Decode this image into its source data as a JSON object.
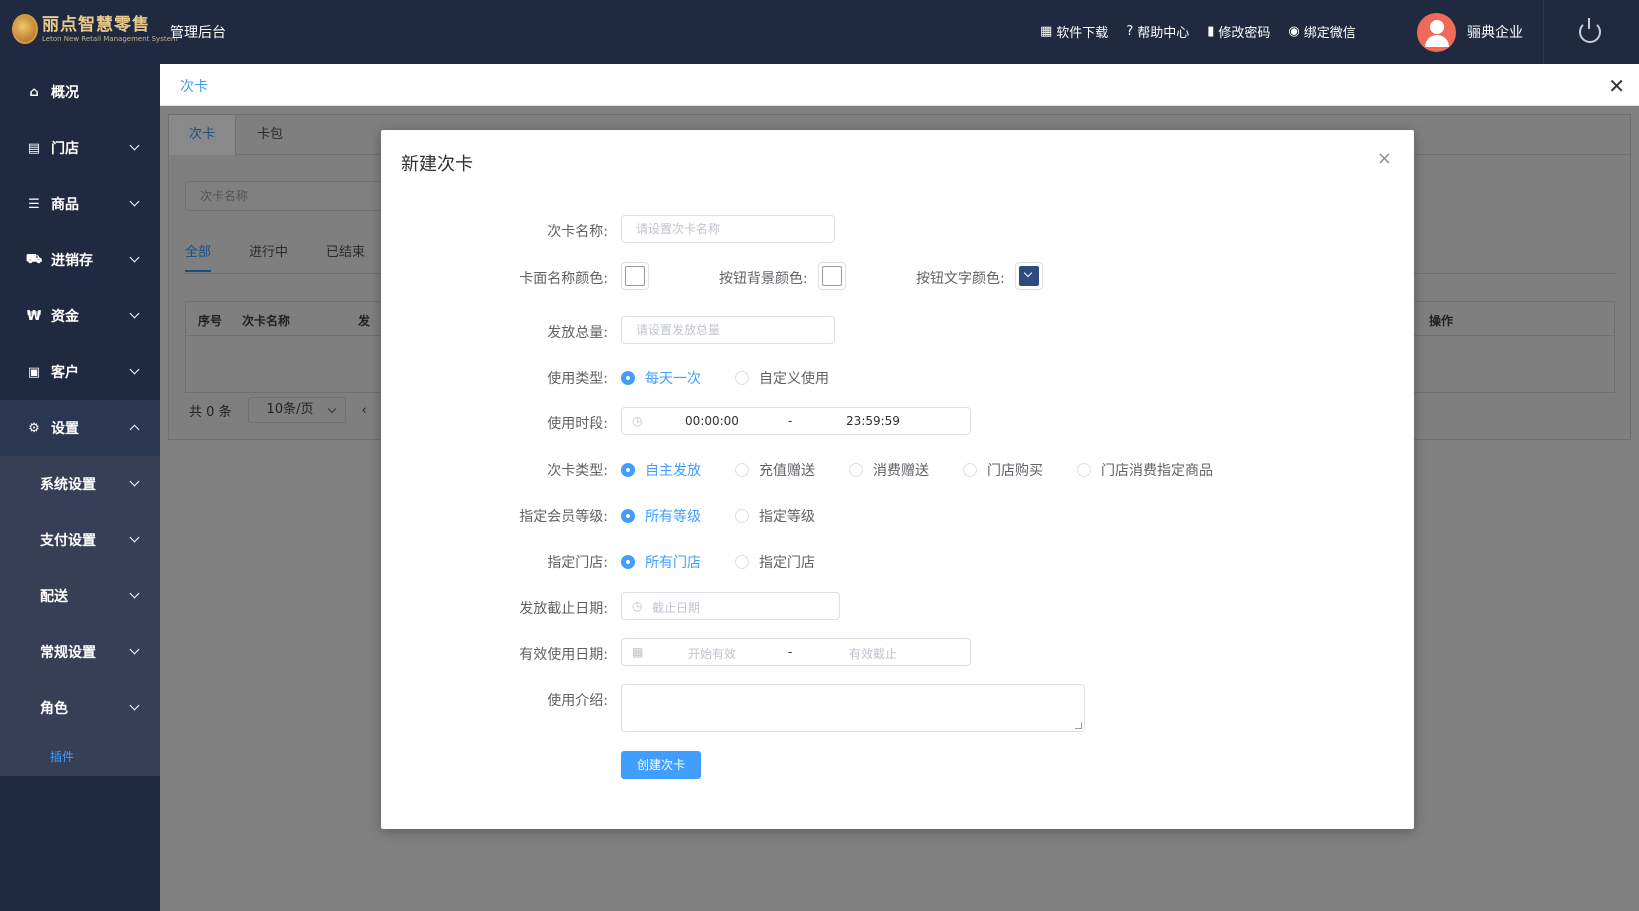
{
  "header": {
    "logo_text": "丽点智慧零售",
    "logo_subtext": "Leton New Retail Management System",
    "admin_title": "管理后台",
    "links": [
      {
        "icon": "store-icon",
        "glyph": "▦",
        "label": "软件下载"
      },
      {
        "icon": "help-icon",
        "glyph": "?",
        "label": "帮助中心"
      },
      {
        "icon": "thermometer-icon",
        "glyph": "▮",
        "label": "修改密码"
      },
      {
        "icon": "wechat-icon",
        "glyph": "◉",
        "label": "绑定微信"
      }
    ],
    "company": "骊典企业",
    "avatar_color": "#ef6a58"
  },
  "sidebar": {
    "items": [
      {
        "icon": "home-icon",
        "glyph": "⌂",
        "label": "概况"
      },
      {
        "icon": "document-icon",
        "glyph": "▤",
        "label": "门店"
      },
      {
        "icon": "list-icon",
        "glyph": "☰",
        "label": "商品"
      },
      {
        "icon": "truck-icon",
        "glyph": "⛟",
        "label": "进销存"
      },
      {
        "icon": "won-icon",
        "glyph": "₩",
        "label": "资金"
      },
      {
        "icon": "id-card-icon",
        "glyph": "▣",
        "label": "客户"
      },
      {
        "icon": "gear-icon",
        "glyph": "⚙",
        "label": "设置"
      }
    ],
    "sub_items": [
      "系统设置",
      "支付设置",
      "配送",
      "常规设置",
      "角色"
    ],
    "leaf": "插件"
  },
  "content": {
    "page_title": "次卡",
    "tabs": [
      "次卡",
      "卡包"
    ],
    "search_placeholder": "次卡名称",
    "status_tabs": [
      "全部",
      "进行中",
      "已结束"
    ],
    "table_headers": [
      "序号",
      "次卡名称",
      "发",
      "操作"
    ],
    "total": "共 0 条",
    "page_size": "10条/页",
    "prev": "‹"
  },
  "modal": {
    "title": "新建次卡",
    "close": "×",
    "name_label": "次卡名称:",
    "name_placeholder": "请设置次卡名称",
    "card_name_color_label": "卡面名称颜色:",
    "button_bg_color_label": "按钮背景颜色:",
    "button_text_color_label": "按钮文字颜色:",
    "button_text_color": "#2e4a7e",
    "total_label": "发放总量:",
    "total_placeholder": "请设置发放总量",
    "use_type_label": "使用类型:",
    "use_type_options": [
      "每天一次",
      "自定义使用"
    ],
    "use_time_label": "使用时段:",
    "use_time_start": "00:00:00",
    "use_time_sep": "-",
    "use_time_end": "23:59:59",
    "card_type_label": "次卡类型:",
    "card_type_options": [
      "自主发放",
      "充值赠送",
      "消费赠送",
      "门店购买",
      "门店消费指定商品"
    ],
    "member_level_label": "指定会员等级:",
    "member_level_options": [
      "所有等级",
      "指定等级"
    ],
    "store_label": "指定门店:",
    "store_options": [
      "所有门店",
      "指定门店"
    ],
    "deadline_label": "发放截止日期:",
    "deadline_placeholder": "截止日期",
    "valid_label": "有效使用日期:",
    "valid_start_placeholder": "开始有效",
    "valid_sep": "-",
    "valid_end_placeholder": "有效截止",
    "intro_label": "使用介绍:",
    "submit_label": "创建次卡"
  }
}
